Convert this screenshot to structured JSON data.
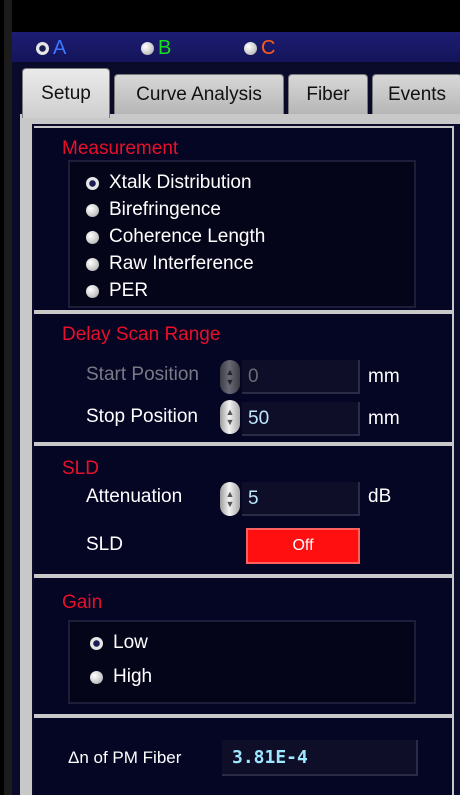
{
  "channels": [
    {
      "label": "A",
      "color": "#3a78ff",
      "selected": true
    },
    {
      "label": "B",
      "color": "#18e018",
      "selected": false
    },
    {
      "label": "C",
      "color": "#ff5a1a",
      "selected": false
    }
  ],
  "tabs": [
    {
      "label": "Setup",
      "active": true
    },
    {
      "label": "Curve Analysis",
      "active": false
    },
    {
      "label": "Fiber",
      "active": false
    },
    {
      "label": "Events",
      "active": false
    }
  ],
  "measurement": {
    "title": "Measurement",
    "options": [
      {
        "label": "Xtalk Distribution",
        "selected": true
      },
      {
        "label": "Birefringence",
        "selected": false
      },
      {
        "label": "Coherence Length",
        "selected": false
      },
      {
        "label": "Raw Interference",
        "selected": false
      },
      {
        "label": "PER",
        "selected": false
      }
    ]
  },
  "delay_scan": {
    "title": "Delay Scan Range",
    "start_label": "Start Position",
    "start_value": "0",
    "start_unit": "mm",
    "stop_label": "Stop Position",
    "stop_value": "50",
    "stop_unit": "mm"
  },
  "sld": {
    "title": "SLD",
    "attenuation_label": "Attenuation",
    "attenuation_value": "5",
    "attenuation_unit": "dB",
    "sld_label": "SLD",
    "sld_button": "Off"
  },
  "gain": {
    "title": "Gain",
    "options": [
      {
        "label": "Low",
        "selected": true
      },
      {
        "label": "High",
        "selected": false
      }
    ]
  },
  "fiber": {
    "dn_label": "Δn of PM Fiber",
    "dn_value": "3.81E-4"
  }
}
